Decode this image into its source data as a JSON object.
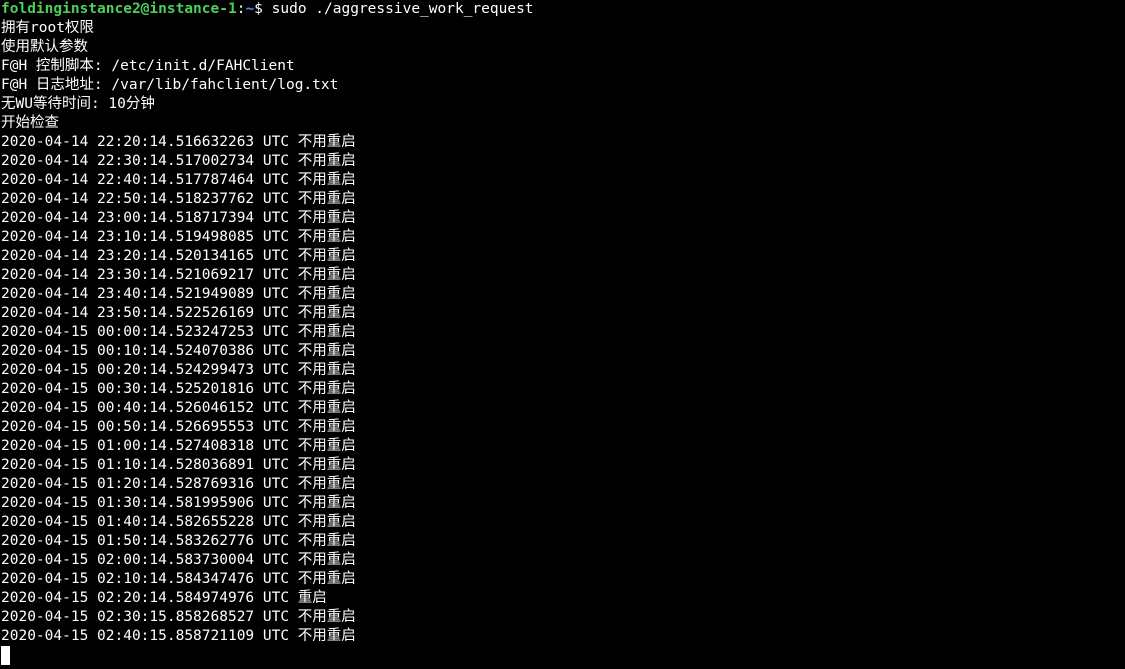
{
  "prompt": {
    "user_host": "foldinginstance2@instance-1",
    "sep": ":",
    "path": "~",
    "symbol": "$ ",
    "command": "sudo ./aggressive_work_request"
  },
  "info_lines": [
    "拥有root权限",
    "使用默认参数",
    "F@H 控制脚本: /etc/init.d/FAHClient",
    "F@H 日志地址: /var/lib/fahclient/log.txt",
    "无WU等待时间: 10分钟",
    "开始检查"
  ],
  "log_lines": [
    "2020-04-14 22:20:14.516632263 UTC 不用重启",
    "2020-04-14 22:30:14.517002734 UTC 不用重启",
    "2020-04-14 22:40:14.517787464 UTC 不用重启",
    "2020-04-14 22:50:14.518237762 UTC 不用重启",
    "2020-04-14 23:00:14.518717394 UTC 不用重启",
    "2020-04-14 23:10:14.519498085 UTC 不用重启",
    "2020-04-14 23:20:14.520134165 UTC 不用重启",
    "2020-04-14 23:30:14.521069217 UTC 不用重启",
    "2020-04-14 23:40:14.521949089 UTC 不用重启",
    "2020-04-14 23:50:14.522526169 UTC 不用重启",
    "2020-04-15 00:00:14.523247253 UTC 不用重启",
    "2020-04-15 00:10:14.524070386 UTC 不用重启",
    "2020-04-15 00:20:14.524299473 UTC 不用重启",
    "2020-04-15 00:30:14.525201816 UTC 不用重启",
    "2020-04-15 00:40:14.526046152 UTC 不用重启",
    "2020-04-15 00:50:14.526695553 UTC 不用重启",
    "2020-04-15 01:00:14.527408318 UTC 不用重启",
    "2020-04-15 01:10:14.528036891 UTC 不用重启",
    "2020-04-15 01:20:14.528769316 UTC 不用重启",
    "2020-04-15 01:30:14.581995906 UTC 不用重启",
    "2020-04-15 01:40:14.582655228 UTC 不用重启",
    "2020-04-15 01:50:14.583262776 UTC 不用重启",
    "2020-04-15 02:00:14.583730004 UTC 不用重启",
    "2020-04-15 02:10:14.584347476 UTC 不用重启",
    "2020-04-15 02:20:14.584974976 UTC 重启",
    "2020-04-15 02:30:15.858268527 UTC 不用重启",
    "2020-04-15 02:40:15.858721109 UTC 不用重启"
  ],
  "colors": {
    "background": "#000000",
    "text": "#ffffff",
    "prompt_user": "#4cd05a",
    "prompt_path": "#4f88ff"
  }
}
